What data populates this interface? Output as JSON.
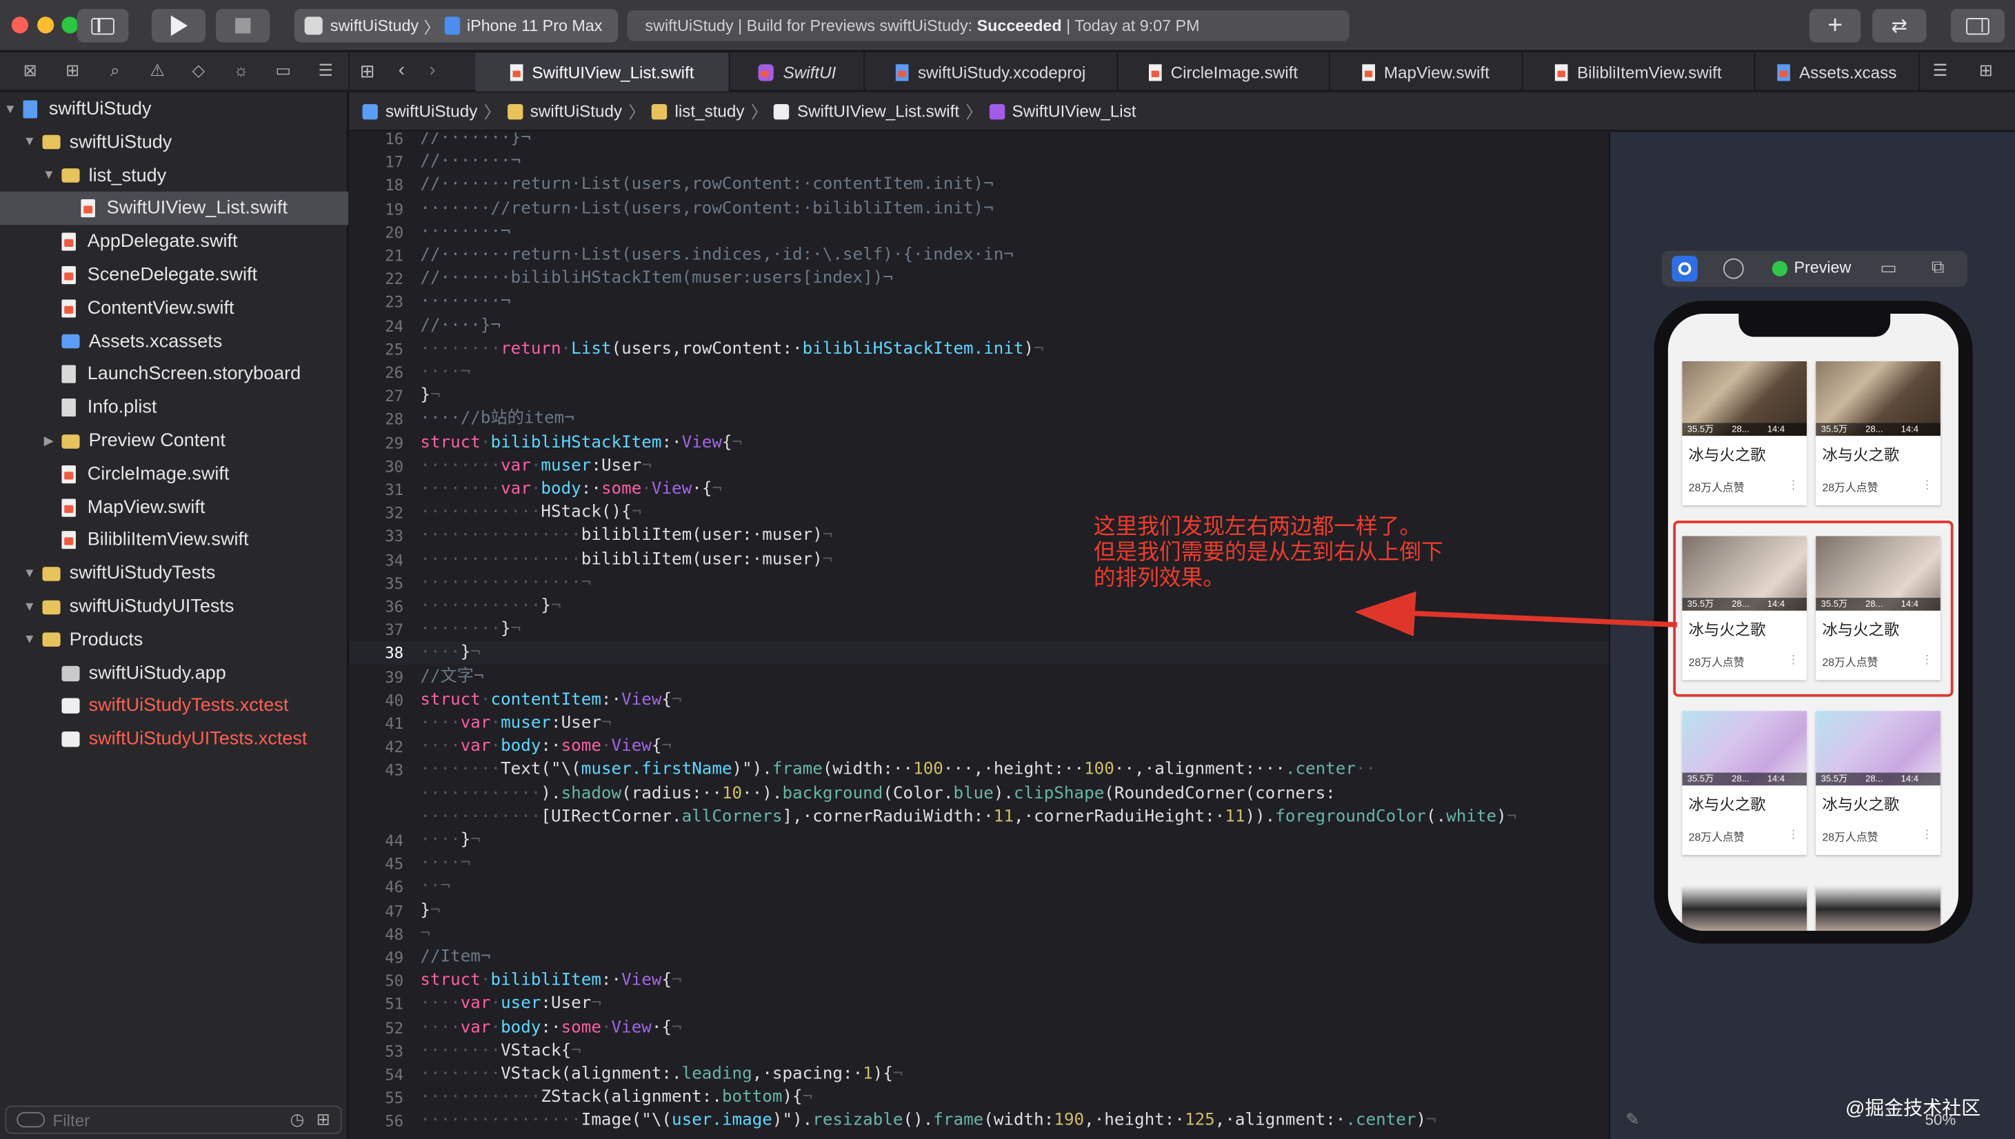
{
  "toolbar": {
    "scheme_name": "swiftUiStudy",
    "device": "iPhone 11 Pro Max",
    "activity_prefix": "swiftUiStudy | Build for Previews swiftUiStudy: ",
    "activity_status": "Succeeded",
    "activity_suffix": " | Today at 9:07 PM"
  },
  "navigator": {
    "items": [
      {
        "label": "swiftUiStudy",
        "kind": "project",
        "depth": 0
      },
      {
        "label": "swiftUiStudy",
        "kind": "folder",
        "depth": 1
      },
      {
        "label": "list_study",
        "kind": "folder",
        "depth": 2,
        "expanded": true
      },
      {
        "label": "SwiftUIView_List.swift",
        "kind": "swift",
        "depth": 3,
        "selected": true
      },
      {
        "label": "AppDelegate.swift",
        "kind": "swift",
        "depth": 2
      },
      {
        "label": "SceneDelegate.swift",
        "kind": "swift",
        "depth": 2
      },
      {
        "label": "ContentView.swift",
        "kind": "swift",
        "depth": 2
      },
      {
        "label": "Assets.xcassets",
        "kind": "asset",
        "depth": 2
      },
      {
        "label": "LaunchScreen.storyboard",
        "kind": "file",
        "depth": 2
      },
      {
        "label": "Info.plist",
        "kind": "file",
        "depth": 2
      },
      {
        "label": "Preview Content",
        "kind": "folder",
        "depth": 2,
        "collapsed": true
      },
      {
        "label": "CircleImage.swift",
        "kind": "swift",
        "depth": 2
      },
      {
        "label": "MapView.swift",
        "kind": "swift",
        "depth": 2
      },
      {
        "label": "BilibliItemView.swift",
        "kind": "swift",
        "depth": 2
      },
      {
        "label": "swiftUiStudyTests",
        "kind": "folder",
        "depth": 1
      },
      {
        "label": "swiftUiStudyUITests",
        "kind": "folder",
        "depth": 1
      },
      {
        "label": "Products",
        "kind": "folder",
        "depth": 1
      },
      {
        "label": "swiftUiStudy.app",
        "kind": "app",
        "depth": 2
      },
      {
        "label": "swiftUiStudyTests.xctest",
        "kind": "test",
        "depth": 2,
        "missing": true
      },
      {
        "label": "swiftUiStudyUITests.xctest",
        "kind": "test",
        "depth": 2,
        "missing": true
      }
    ],
    "filter_placeholder": "Filter"
  },
  "tabs": [
    {
      "label": "SwiftUIView_List.swift",
      "active": true
    },
    {
      "label": "SwiftUI"
    },
    {
      "label": "swiftUiStudy.xcodeproj"
    },
    {
      "label": "CircleImage.swift"
    },
    {
      "label": "MapView.swift"
    },
    {
      "label": "BilibliItemView.swift"
    },
    {
      "label": "Assets.xcass"
    }
  ],
  "breadcrumb": [
    "swiftUiStudy",
    "swiftUiStudy",
    "list_study",
    "SwiftUIView_List.swift",
    "SwiftUIView_List"
  ],
  "code": {
    "current_line": 38,
    "lines": [
      {
        "n": "16",
        "segs": [
          [
            "c",
            "//·······}¬"
          ]
        ]
      },
      {
        "n": "17",
        "segs": [
          [
            "c",
            "//·······¬"
          ]
        ]
      },
      {
        "n": "18",
        "segs": [
          [
            "c",
            "//·······return·List(users,rowContent:·contentItem.init)¬"
          ]
        ]
      },
      {
        "n": "19",
        "segs": [
          [
            "c",
            "·······//return·List(users,rowContent:·bilibliItem.init)¬"
          ]
        ]
      },
      {
        "n": "20",
        "segs": [
          [
            "c",
            "········¬"
          ]
        ]
      },
      {
        "n": "21",
        "segs": [
          [
            "c",
            "//·······return·List(users.indices,·id:·\\.self)·{·index·in¬"
          ]
        ]
      },
      {
        "n": "22",
        "segs": [
          [
            "c",
            "//·······bilibliHStackItem(muser:users[index])¬"
          ]
        ]
      },
      {
        "n": "23",
        "segs": [
          [
            "c",
            "········¬"
          ]
        ]
      },
      {
        "n": "24",
        "segs": [
          [
            "c",
            "//····}¬"
          ]
        ]
      },
      {
        "n": "25",
        "segs": [
          [
            "w",
            "········"
          ],
          [
            "k",
            "return"
          ],
          [
            "w",
            "·"
          ],
          [
            "t",
            "List"
          ],
          [
            "d",
            "(users,rowContent:·"
          ],
          [
            "t",
            "bilibliHStackItem.init"
          ],
          [
            "d",
            ")"
          ],
          [
            "w",
            "¬"
          ]
        ]
      },
      {
        "n": "26",
        "segs": [
          [
            "w",
            "····¬"
          ]
        ]
      },
      {
        "n": "27",
        "segs": [
          [
            "d",
            "}"
          ],
          [
            "w",
            "¬"
          ]
        ]
      },
      {
        "n": "28",
        "segs": [
          [
            "c",
            "····//b站的item¬"
          ]
        ]
      },
      {
        "n": "29",
        "segs": [
          [
            "k",
            "struct"
          ],
          [
            "w",
            "·"
          ],
          [
            "t",
            "bilibliHStackItem"
          ],
          [
            "d",
            ":·"
          ],
          [
            "p",
            "View"
          ],
          [
            "d",
            "{"
          ],
          [
            "w",
            "¬"
          ]
        ]
      },
      {
        "n": "30",
        "segs": [
          [
            "w",
            "········"
          ],
          [
            "k",
            "var"
          ],
          [
            "w",
            "·"
          ],
          [
            "t",
            "muser"
          ],
          [
            "d",
            ":User"
          ],
          [
            "w",
            "¬"
          ]
        ]
      },
      {
        "n": "31",
        "segs": [
          [
            "w",
            "········"
          ],
          [
            "k",
            "var"
          ],
          [
            "w",
            "·"
          ],
          [
            "t",
            "body"
          ],
          [
            "d",
            ":·"
          ],
          [
            "k",
            "some"
          ],
          [
            "w",
            "·"
          ],
          [
            "p",
            "View"
          ],
          [
            "d",
            "·{"
          ],
          [
            "w",
            "¬"
          ]
        ]
      },
      {
        "n": "32",
        "segs": [
          [
            "w",
            "············"
          ],
          [
            "d",
            "HStack(){"
          ],
          [
            "w",
            "¬"
          ]
        ]
      },
      {
        "n": "33",
        "segs": [
          [
            "w",
            "················"
          ],
          [
            "d",
            "bilibliItem(user:·muser)"
          ],
          [
            "w",
            "¬"
          ]
        ]
      },
      {
        "n": "34",
        "segs": [
          [
            "w",
            "················"
          ],
          [
            "d",
            "bilibliItem(user:·muser)"
          ],
          [
            "w",
            "¬"
          ]
        ]
      },
      {
        "n": "35",
        "segs": [
          [
            "w",
            "················¬"
          ]
        ]
      },
      {
        "n": "36",
        "segs": [
          [
            "w",
            "············"
          ],
          [
            "d",
            "}"
          ],
          [
            "w",
            "¬"
          ]
        ]
      },
      {
        "n": "37",
        "segs": [
          [
            "w",
            "········"
          ],
          [
            "d",
            "}"
          ],
          [
            "w",
            "¬"
          ]
        ]
      },
      {
        "n": "38",
        "segs": [
          [
            "w",
            "····"
          ],
          [
            "d",
            "}"
          ],
          [
            "w",
            "¬"
          ]
        ]
      },
      {
        "n": "39",
        "segs": [
          [
            "c",
            "//文字¬"
          ]
        ]
      },
      {
        "n": "40",
        "segs": [
          [
            "k",
            "struct"
          ],
          [
            "w",
            "·"
          ],
          [
            "t",
            "contentItem"
          ],
          [
            "d",
            ":·"
          ],
          [
            "p",
            "View"
          ],
          [
            "d",
            "{"
          ],
          [
            "w",
            "¬"
          ]
        ]
      },
      {
        "n": "41",
        "segs": [
          [
            "w",
            "····"
          ],
          [
            "k",
            "var"
          ],
          [
            "w",
            "·"
          ],
          [
            "t",
            "muser"
          ],
          [
            "d",
            ":User"
          ],
          [
            "w",
            "¬"
          ]
        ]
      },
      {
        "n": "42",
        "segs": [
          [
            "w",
            "····"
          ],
          [
            "k",
            "var"
          ],
          [
            "w",
            "·"
          ],
          [
            "t",
            "body"
          ],
          [
            "d",
            ":·"
          ],
          [
            "k",
            "some"
          ],
          [
            "w",
            "·"
          ],
          [
            "p",
            "View"
          ],
          [
            "d",
            "{"
          ],
          [
            "w",
            "¬"
          ]
        ]
      },
      {
        "n": "43",
        "segs": [
          [
            "w",
            "········"
          ],
          [
            "d",
            "Text(\"\\("
          ],
          [
            "t",
            "muser.firstName"
          ],
          [
            "d",
            ")\")."
          ],
          [
            "f",
            "frame"
          ],
          [
            "d",
            "(width:··"
          ],
          [
            "n",
            "100"
          ],
          [
            "d",
            "···,·height:··"
          ],
          [
            "n",
            "100"
          ],
          [
            "d",
            "··,·alignment:···"
          ],
          [
            "f",
            ".center"
          ],
          [
            "w",
            "··"
          ]
        ]
      },
      {
        "n": "",
        "segs": [
          [
            "w",
            "············"
          ],
          [
            "d",
            ")."
          ],
          [
            "f",
            "shadow"
          ],
          [
            "d",
            "(radius:··"
          ],
          [
            "n",
            "10"
          ],
          [
            "d",
            "··)."
          ],
          [
            "f",
            "background"
          ],
          [
            "d",
            "(Color."
          ],
          [
            "f",
            "blue"
          ],
          [
            "d",
            ")."
          ],
          [
            "f",
            "clipShape"
          ],
          [
            "d",
            "(RoundedCorner(corners:"
          ]
        ]
      },
      {
        "n": "",
        "segs": [
          [
            "w",
            "············"
          ],
          [
            "d",
            "[UIRectCorner."
          ],
          [
            "f",
            "allCorners"
          ],
          [
            "d",
            "],·cornerRaduiWidth:·"
          ],
          [
            "n",
            "11"
          ],
          [
            "d",
            ",·cornerRaduiHeight:·"
          ],
          [
            "n",
            "11"
          ],
          [
            "d",
            "))."
          ],
          [
            "f",
            "foregroundColor"
          ],
          [
            "d",
            "(."
          ],
          [
            "f",
            "white"
          ],
          [
            "d",
            ")"
          ],
          [
            "w",
            "¬"
          ]
        ]
      },
      {
        "n": "44",
        "segs": [
          [
            "w",
            "····"
          ],
          [
            "d",
            "}"
          ],
          [
            "w",
            "¬"
          ]
        ]
      },
      {
        "n": "45",
        "segs": [
          [
            "w",
            "····¬"
          ]
        ]
      },
      {
        "n": "46",
        "segs": [
          [
            "w",
            "··¬"
          ]
        ]
      },
      {
        "n": "47",
        "segs": [
          [
            "d",
            "}"
          ],
          [
            "w",
            "¬"
          ]
        ]
      },
      {
        "n": "48",
        "segs": [
          [
            "w",
            "¬"
          ]
        ]
      },
      {
        "n": "49",
        "segs": [
          [
            "c",
            "//Item¬"
          ]
        ]
      },
      {
        "n": "50",
        "segs": [
          [
            "k",
            "struct"
          ],
          [
            "w",
            "·"
          ],
          [
            "t",
            "bilibliItem"
          ],
          [
            "d",
            ":·"
          ],
          [
            "p",
            "View"
          ],
          [
            "d",
            "{"
          ],
          [
            "w",
            "¬"
          ]
        ]
      },
      {
        "n": "51",
        "segs": [
          [
            "w",
            "····"
          ],
          [
            "k",
            "var"
          ],
          [
            "w",
            "·"
          ],
          [
            "t",
            "user"
          ],
          [
            "d",
            ":User"
          ],
          [
            "w",
            "¬"
          ]
        ]
      },
      {
        "n": "52",
        "segs": [
          [
            "w",
            "····"
          ],
          [
            "k",
            "var"
          ],
          [
            "w",
            "·"
          ],
          [
            "t",
            "body"
          ],
          [
            "d",
            ":·"
          ],
          [
            "k",
            "some"
          ],
          [
            "w",
            "·"
          ],
          [
            "p",
            "View"
          ],
          [
            "d",
            "·{"
          ],
          [
            "w",
            "¬"
          ]
        ]
      },
      {
        "n": "53",
        "segs": [
          [
            "w",
            "········"
          ],
          [
            "d",
            "VStack{"
          ],
          [
            "w",
            "¬"
          ]
        ]
      },
      {
        "n": "54",
        "segs": [
          [
            "w",
            "········"
          ],
          [
            "d",
            "VStack(alignment:."
          ],
          [
            "f",
            "leading"
          ],
          [
            "d",
            ",·spacing:·"
          ],
          [
            "n",
            "1"
          ],
          [
            "d",
            "){"
          ],
          [
            "w",
            "¬"
          ]
        ]
      },
      {
        "n": "55",
        "segs": [
          [
            "w",
            "············"
          ],
          [
            "d",
            "ZStack(alignment:."
          ],
          [
            "f",
            "bottom"
          ],
          [
            "d",
            "){"
          ],
          [
            "w",
            "¬"
          ]
        ]
      },
      {
        "n": "56",
        "segs": [
          [
            "w",
            "················"
          ],
          [
            "d",
            "Image(\"\\("
          ],
          [
            "t",
            "user.image"
          ],
          [
            "d",
            ")\")."
          ],
          [
            "f",
            "resizable"
          ],
          [
            "d",
            "()."
          ],
          [
            "f",
            "frame"
          ],
          [
            "d",
            "(width:"
          ],
          [
            "n",
            "190"
          ],
          [
            "d",
            ",·height:·"
          ],
          [
            "n",
            "125"
          ],
          [
            "d",
            ",·alignment:·"
          ],
          [
            "f",
            ".center"
          ],
          [
            "d",
            ")"
          ],
          [
            "w",
            "¬"
          ]
        ]
      }
    ]
  },
  "preview": {
    "label": "Preview",
    "zoom": "50%",
    "cards": [
      {
        "title": "冰与火之歌",
        "likes": "28万人点赞",
        "views": "35.5万",
        "danmaku": "28...",
        "duration": "14:4",
        "theme": "people"
      },
      {
        "title": "冰与火之歌",
        "likes": "28万人点赞",
        "views": "35.5万",
        "danmaku": "28...",
        "duration": "14:4",
        "theme": "people"
      },
      {
        "title": "冰与火之歌",
        "likes": "28万人点赞",
        "views": "35.5万",
        "danmaku": "28...",
        "duration": "14:4",
        "theme": "faces"
      },
      {
        "title": "冰与火之歌",
        "likes": "28万人点赞",
        "views": "35.5万",
        "danmaku": "28...",
        "duration": "14:4",
        "theme": "faces"
      },
      {
        "title": "冰与火之歌",
        "likes": "28万人点赞",
        "views": "35.5万",
        "danmaku": "28...",
        "duration": "14:4",
        "theme": "anime"
      },
      {
        "title": "冰与火之歌",
        "likes": "28万人点赞",
        "views": "35.5万",
        "danmaku": "28...",
        "duration": "14:4",
        "theme": "anime"
      }
    ]
  },
  "annotation": {
    "lines": [
      "这里我们发现左右两边都一样了。",
      "但是我们需要的是从左到右从上倒下",
      "的排列效果。"
    ]
  },
  "watermark": "@掘金技术社区",
  "colors": {
    "accent": "#f03c2c",
    "keyword": "#fc5fa3",
    "type": "#5dd8ff",
    "comment": "#6c7986",
    "number": "#d0bf69"
  }
}
